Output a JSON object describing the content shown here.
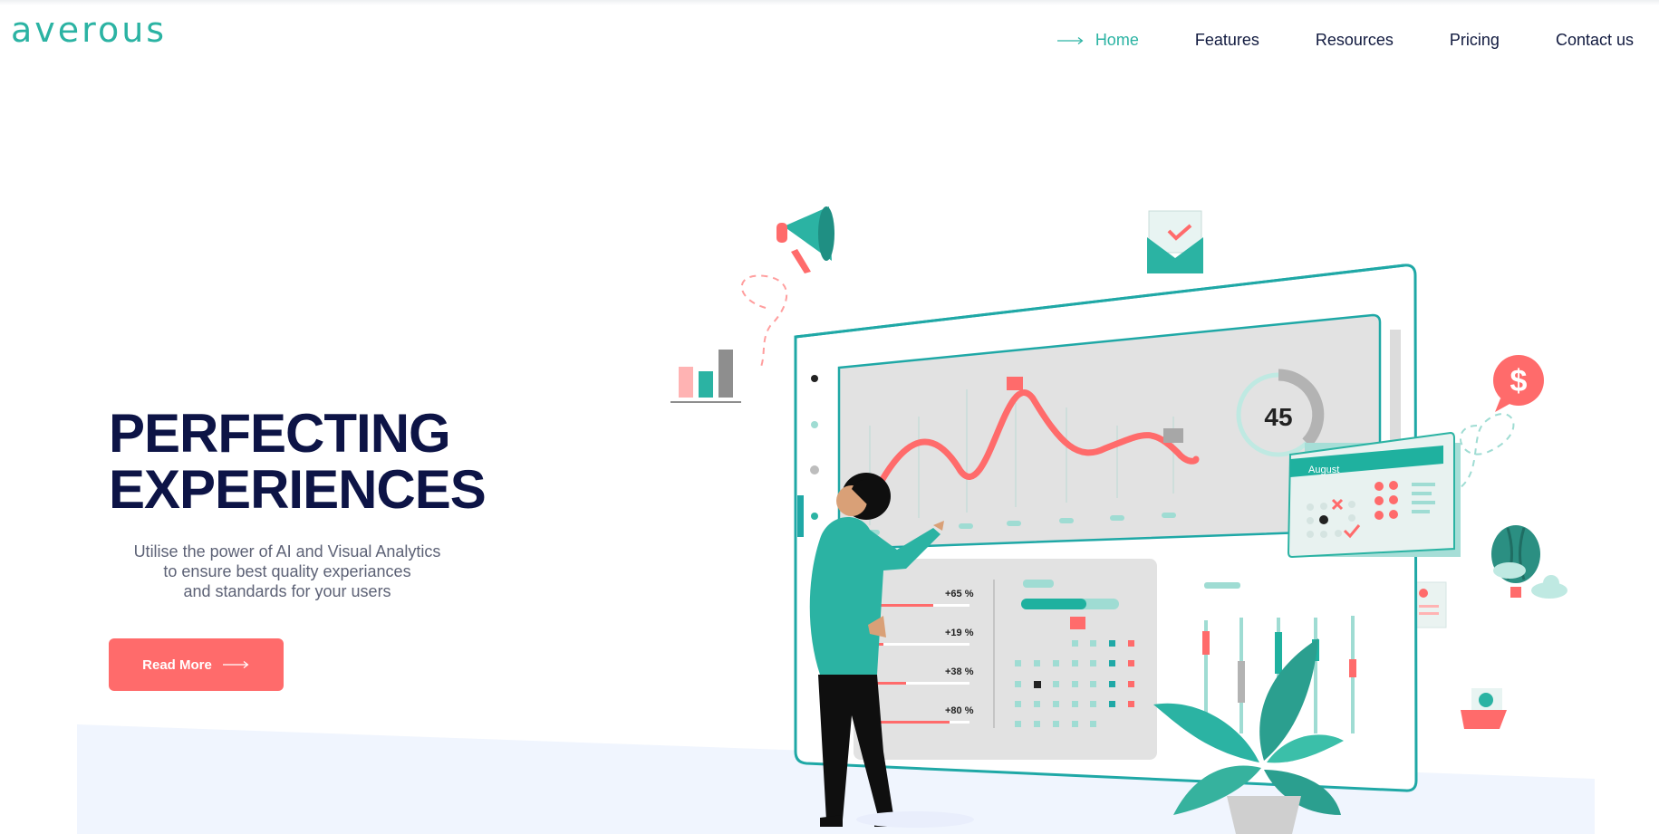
{
  "brand": {
    "logo_text": "averous"
  },
  "nav": {
    "items": [
      {
        "label": "Home",
        "active": true
      },
      {
        "label": "Features",
        "active": false
      },
      {
        "label": "Resources",
        "active": false
      },
      {
        "label": "Pricing",
        "active": false
      },
      {
        "label": "Contact us",
        "active": false
      }
    ]
  },
  "hero": {
    "title_line1": "PERFECTING",
    "title_line2": "EXPERIENCES",
    "subtitle_line1": "Utilise the power of AI and Visual Analytics",
    "subtitle_line2": "to ensure best quality experiances",
    "subtitle_line3": "and standards for your users",
    "cta_label": "Read More"
  },
  "illustration": {
    "gauge_value": "45",
    "calendar_month": "August",
    "stats": [
      "+65 %",
      "+19 %",
      "+38 %",
      "+80 %"
    ]
  },
  "colors": {
    "brand_teal": "#2bb3a3",
    "navy": "#0d1446",
    "coral": "#ff6b6b",
    "band": "#f0f5fe"
  }
}
